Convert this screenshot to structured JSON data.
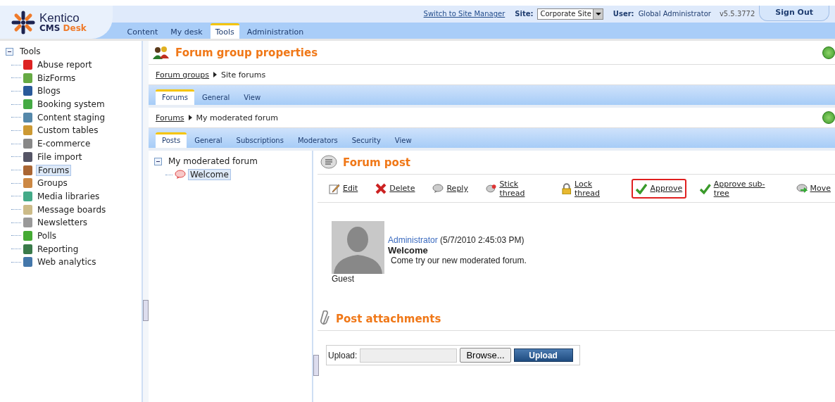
{
  "header": {
    "logo": {
      "name": "Kentico",
      "product": "CMS",
      "edition": "Desk"
    },
    "tabs": [
      {
        "label": "Content",
        "selected": false
      },
      {
        "label": "My desk",
        "selected": false
      },
      {
        "label": "Tools",
        "selected": true
      },
      {
        "label": "Administration",
        "selected": false
      }
    ],
    "switch_link": "Switch to Site Manager",
    "site_label": "Site:",
    "site_value": "Corporate Site",
    "user_label": "User:",
    "user_name": "Global Administrator",
    "version": "v5.5.3772",
    "sign_out": "Sign Out"
  },
  "sidebar": {
    "root": "Tools",
    "expanded": true,
    "items": [
      {
        "label": "Abuse report",
        "selected": false
      },
      {
        "label": "BizForms",
        "selected": false
      },
      {
        "label": "Blogs",
        "selected": false
      },
      {
        "label": "Booking system",
        "selected": false
      },
      {
        "label": "Content staging",
        "selected": false
      },
      {
        "label": "Custom tables",
        "selected": false
      },
      {
        "label": "E-commerce",
        "selected": false
      },
      {
        "label": "File import",
        "selected": false
      },
      {
        "label": "Forums",
        "selected": true
      },
      {
        "label": "Groups",
        "selected": false
      },
      {
        "label": "Media libraries",
        "selected": false
      },
      {
        "label": "Message boards",
        "selected": false
      },
      {
        "label": "Newsletters",
        "selected": false
      },
      {
        "label": "Polls",
        "selected": false
      },
      {
        "label": "Reporting",
        "selected": false
      },
      {
        "label": "Web analytics",
        "selected": false
      }
    ]
  },
  "page": {
    "title": "Forum group properties",
    "breadcrumb1": {
      "link": "Forum groups",
      "current": "Site forums"
    },
    "tabs1": [
      {
        "label": "Forums",
        "selected": true
      },
      {
        "label": "General",
        "selected": false
      },
      {
        "label": "View",
        "selected": false
      }
    ],
    "breadcrumb2": {
      "link": "Forums",
      "current": "My moderated forum"
    },
    "tabs2": [
      {
        "label": "Posts",
        "selected": true
      },
      {
        "label": "General",
        "selected": false
      },
      {
        "label": "Subscriptions",
        "selected": false
      },
      {
        "label": "Moderators",
        "selected": false
      },
      {
        "label": "Security",
        "selected": false
      },
      {
        "label": "View",
        "selected": false
      }
    ]
  },
  "tree": {
    "root": "My moderated forum",
    "expanded": true,
    "children": [
      {
        "label": "Welcome",
        "selected": true
      }
    ]
  },
  "post": {
    "title": "Forum post",
    "actions": [
      {
        "label": "Edit",
        "kind": "edit",
        "highlighted": false
      },
      {
        "label": "Delete",
        "kind": "delete",
        "highlighted": false
      },
      {
        "label": "Reply",
        "kind": "reply",
        "highlighted": false
      },
      {
        "label": "Stick thread",
        "kind": "stick",
        "highlighted": false
      },
      {
        "label": "Lock thread",
        "kind": "lock",
        "highlighted": false
      },
      {
        "label": "Approve",
        "kind": "approve",
        "highlighted": true
      },
      {
        "label": "Approve sub-tree",
        "kind": "approve",
        "highlighted": false
      },
      {
        "label": "Move",
        "kind": "move",
        "highlighted": false
      }
    ],
    "author_role": "Guest",
    "author": "Administrator",
    "date": "(5/7/2010 2:45:03 PM)",
    "subject": "Welcome",
    "text": "Come try our new moderated forum."
  },
  "attachments": {
    "title": "Post attachments",
    "upload_label": "Upload:",
    "browse": "Browse...",
    "upload": "Upload"
  }
}
